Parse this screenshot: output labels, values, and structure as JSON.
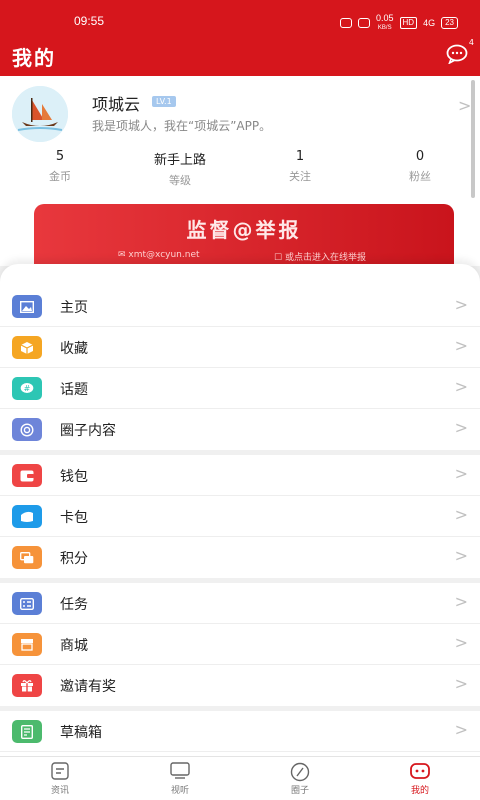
{
  "status_bar": {
    "time": "09:55",
    "net_speed": "0.05",
    "net_unit": "KB/S",
    "hd": "HD",
    "signal": "4G",
    "battery": "23"
  },
  "header": {
    "title": "我的",
    "message_badge": "4",
    "message_icon": "chat-icon"
  },
  "profile": {
    "name": "项城云",
    "level": "LV.1",
    "signature": "我是项城人，我在“项城云”APP。",
    "stats": [
      {
        "value": "5",
        "label": "金币"
      },
      {
        "value": "新手上路",
        "label": "等级"
      },
      {
        "value": "1",
        "label": "关注"
      },
      {
        "value": "0",
        "label": "粉丝"
      }
    ]
  },
  "banner": {
    "title": "监督@举报",
    "email": "xmt@xcyun.net",
    "link": "或点击进入在线举报"
  },
  "menu": {
    "groups": [
      [
        {
          "label": "主页",
          "icon": "image-icon",
          "color": "#5b7fd6"
        },
        {
          "label": "收藏",
          "icon": "box-icon",
          "color": "#f5a623"
        },
        {
          "label": "话题",
          "icon": "hashtag-icon",
          "color": "#2dc6b4"
        },
        {
          "label": "圈子内容",
          "icon": "circle-icon",
          "color": "#6e85d9"
        }
      ],
      [
        {
          "label": "钱包",
          "icon": "wallet-icon",
          "color": "#ef4545"
        },
        {
          "label": "卡包",
          "icon": "card-icon",
          "color": "#1e9be9"
        },
        {
          "label": "积分",
          "icon": "points-icon",
          "color": "#f6933a"
        }
      ],
      [
        {
          "label": "任务",
          "icon": "task-icon",
          "color": "#5b7fd6"
        },
        {
          "label": "商城",
          "icon": "store-icon",
          "color": "#f6933a"
        },
        {
          "label": "邀请有奖",
          "icon": "gift-icon",
          "color": "#ef4545"
        }
      ],
      [
        {
          "label": "草稿箱",
          "icon": "draft-icon",
          "color": "#4cba6d"
        }
      ]
    ]
  },
  "tabbar": {
    "tabs": [
      {
        "label": "资讯",
        "icon": "news-icon"
      },
      {
        "label": "视听",
        "icon": "tv-icon"
      },
      {
        "label": "圈子",
        "icon": "compass-icon"
      },
      {
        "label": "我的",
        "icon": "mine-icon",
        "active": true
      }
    ]
  },
  "colors": {
    "brand": "#d6161c",
    "level_badge": "#a6c8ee"
  }
}
